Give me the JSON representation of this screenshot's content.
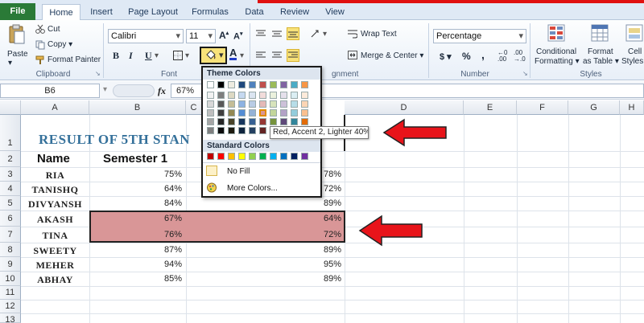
{
  "ribbon_tabs": [
    "File",
    "Home",
    "Insert",
    "Page Layout",
    "Formulas",
    "Data",
    "Review",
    "View"
  ],
  "clipboard": {
    "paste": "Paste",
    "cut": "Cut",
    "copy": "Copy ▾",
    "format_painter": "Format Painter",
    "group_label": "Clipboard"
  },
  "font": {
    "family": "Calibri",
    "size": "11",
    "group_label": "Font",
    "bold": "B",
    "italic": "I",
    "underline": "U"
  },
  "alignment": {
    "wrap_text": "Wrap Text",
    "merge_center": "Merge & Center ▾",
    "group_label": "gnment"
  },
  "number": {
    "format": "Percentage",
    "currency": "$ ▾",
    "percent": "%",
    "comma": ",",
    "group_label": "Number"
  },
  "styles": {
    "conditional": "Conditional",
    "formatting": "Formatting ▾",
    "format_as": "Format",
    "as_table": "as Table ▾",
    "cell": "Cell",
    "cell_styles": "Styles ▾",
    "group_label": "Styles"
  },
  "formula_bar": {
    "name_box": "B6",
    "fx": "fx",
    "value": "67%"
  },
  "columns": [
    "A",
    "B",
    "C",
    "D",
    "E",
    "F",
    "G",
    "H"
  ],
  "rows": [
    "1",
    "2",
    "3",
    "4",
    "5",
    "6",
    "7",
    "8",
    "9",
    "10",
    "11",
    "12",
    "13"
  ],
  "sheet": {
    "title": "RESULT OF 5TH STAN",
    "header_name": "Name",
    "header_sem1": "Semester 1",
    "records": [
      {
        "name": "RIA",
        "s1": "75%",
        "s2": "78%"
      },
      {
        "name": "TANISHQ",
        "s1": "64%",
        "s2": "72%"
      },
      {
        "name": "DIVYANSH",
        "s1": "84%",
        "s2": "89%"
      },
      {
        "name": "AKASH",
        "s1": "67%",
        "s2": "64%"
      },
      {
        "name": "TINA",
        "s1": "76%",
        "s2": "72%"
      },
      {
        "name": "SWEETY",
        "s1": "87%",
        "s2": "89%"
      },
      {
        "name": "MEHER",
        "s1": "94%",
        "s2": "95%"
      },
      {
        "name": "ABHAY",
        "s1": "85%",
        "s2": "89%"
      }
    ]
  },
  "palette": {
    "theme_header": "Theme Colors",
    "standard_header": "Standard Colors",
    "no_fill": "No Fill",
    "more_colors": "More Colors...",
    "tooltip": "Red, Accent 2, Lighter 40%",
    "theme_top": [
      "#ffffff",
      "#000000",
      "#eeece1",
      "#1f497d",
      "#4f81bd",
      "#c0504d",
      "#9bbb59",
      "#8064a2",
      "#4bacc6",
      "#f79646"
    ],
    "theme_shades": [
      [
        "#f2f2f2",
        "#7f7f7f",
        "#ddd9c3",
        "#c6d9f0",
        "#dbe5f1",
        "#f2dcdb",
        "#ebf1dd",
        "#e5e0ec",
        "#dbeef3",
        "#fdeada"
      ],
      [
        "#d8d8d8",
        "#595959",
        "#c4bd97",
        "#8db3e2",
        "#b8cce4",
        "#e5b9b7",
        "#d7e3bc",
        "#ccc1d9",
        "#b7dde8",
        "#fbd5b5"
      ],
      [
        "#bfbfbf",
        "#3f3f3f",
        "#938953",
        "#548dd4",
        "#95b3d7",
        "#d99694",
        "#c3d69b",
        "#b2a2c7",
        "#92cddc",
        "#fac08f"
      ],
      [
        "#a5a5a5",
        "#262626",
        "#494429",
        "#17365d",
        "#366092",
        "#953734",
        "#76923c",
        "#5f497a",
        "#31859b",
        "#e36c09"
      ],
      [
        "#7f7f7f",
        "#0c0c0c",
        "#1d1b10",
        "#0f243e",
        "#244061",
        "#632423",
        "#4f6128",
        "#3f3151",
        "#205867",
        "#974806"
      ]
    ],
    "standard": [
      "#c00000",
      "#ff0000",
      "#ffc000",
      "#ffff00",
      "#92d050",
      "#00b050",
      "#00b0f0",
      "#0070c0",
      "#002060",
      "#7030a0"
    ]
  },
  "colors": {
    "highlight_fill": "#d99697",
    "title_color": "#34709a",
    "arrow_red": "#e8141a",
    "file_tab": "#2a7a37"
  }
}
